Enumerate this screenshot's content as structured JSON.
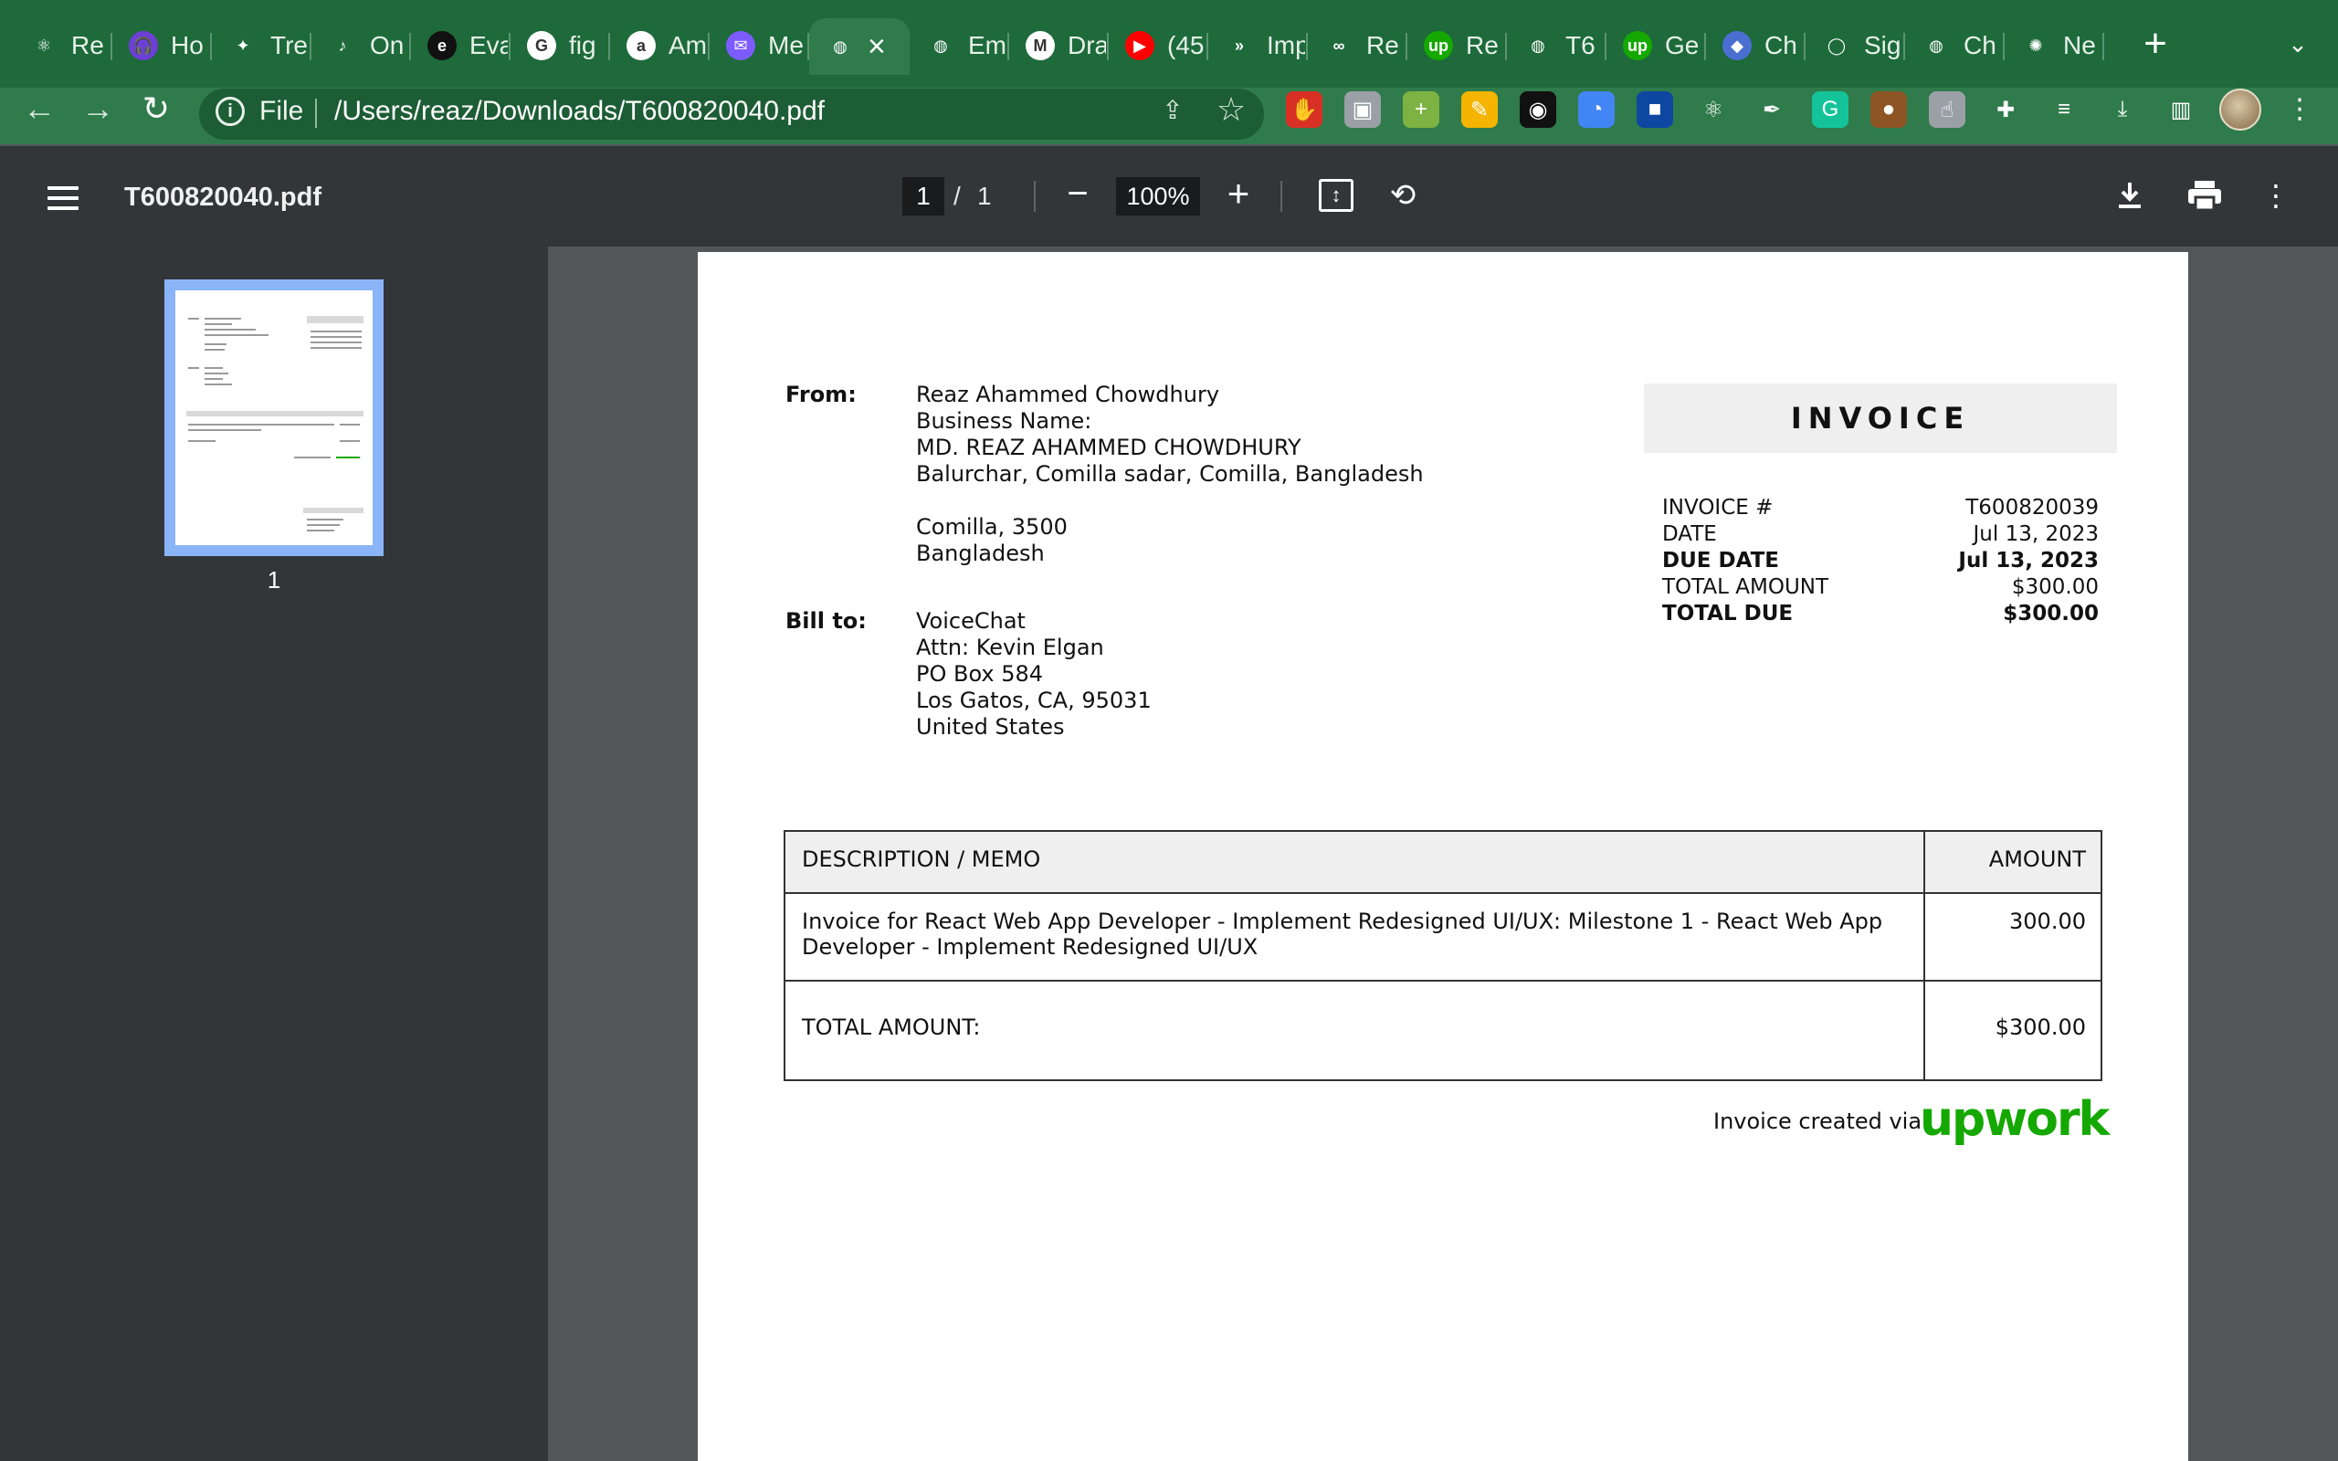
{
  "tabs": [
    {
      "label": "Re",
      "icon": "react-icon",
      "color": "#1e6a3b",
      "glyph": "⚛"
    },
    {
      "label": "Ho",
      "icon": "headphones-icon",
      "color": "#6d3fd6",
      "glyph": "🎧"
    },
    {
      "label": "Tre",
      "icon": "figma-icon",
      "color": "#1e6a3b",
      "glyph": "✦"
    },
    {
      "label": "On",
      "icon": "music-note-icon",
      "color": "#1e6a3b",
      "glyph": "♪"
    },
    {
      "label": "Eva",
      "icon": "e-logo-icon",
      "color": "#111111",
      "glyph": "e"
    },
    {
      "label": "fig",
      "icon": "google-icon",
      "color": "#ffffff",
      "glyph": "G"
    },
    {
      "label": "Am",
      "icon": "amazon-icon",
      "color": "#ffffff",
      "glyph": "a"
    },
    {
      "label": "Me",
      "icon": "messenger-icon",
      "color": "#7c5cff",
      "glyph": "✉"
    },
    {
      "label": "",
      "icon": "globe-icon",
      "color": "#2f7b4b",
      "glyph": "◍",
      "active": true
    },
    {
      "label": "Em",
      "icon": "globe-icon",
      "color": "#1e6a3b",
      "glyph": "◍"
    },
    {
      "label": "Dra",
      "icon": "gmail-icon",
      "color": "#ffffff",
      "glyph": "M"
    },
    {
      "label": "(45",
      "icon": "youtube-icon",
      "color": "#ff0000",
      "glyph": "▶"
    },
    {
      "label": "Imp",
      "icon": "arrows-icon",
      "color": "#1e6a3b",
      "glyph": "»"
    },
    {
      "label": "Re",
      "icon": "knot-icon",
      "color": "#1e6a3b",
      "glyph": "∞"
    },
    {
      "label": "Re",
      "icon": "upwork-icon",
      "color": "#14a800",
      "glyph": "up"
    },
    {
      "label": "T6",
      "icon": "globe-icon",
      "color": "#1e6a3b",
      "glyph": "◍"
    },
    {
      "label": "Ge",
      "icon": "upwork-icon",
      "color": "#14a800",
      "glyph": "up"
    },
    {
      "label": "Ch",
      "icon": "photo-icon",
      "color": "#4a6fd1",
      "glyph": "◆"
    },
    {
      "label": "Sig",
      "icon": "ring-icon",
      "color": "#1e6a3b",
      "glyph": "◯"
    },
    {
      "label": "Ch",
      "icon": "globe-icon",
      "color": "#1e6a3b",
      "glyph": "◍"
    },
    {
      "label": "Ne",
      "icon": "chatgpt-icon",
      "color": "#1e6a3b",
      "glyph": "✺"
    }
  ],
  "browser": {
    "scheme": "File",
    "url": "/Users/reaz/Downloads/T600820040.pdf"
  },
  "extensions": [
    {
      "name": "stop-hand-icon",
      "bg": "#d93025",
      "glyph": "✋"
    },
    {
      "name": "camera-icon",
      "bg": "#9aa0a6",
      "glyph": "▣"
    },
    {
      "name": "plus-circle-icon",
      "bg": "#7cb342",
      "glyph": "+"
    },
    {
      "name": "pencil-color-icon",
      "bg": "#f4b400",
      "glyph": "✎"
    },
    {
      "name": "reader-icon",
      "bg": "#111111",
      "glyph": "◉"
    },
    {
      "name": "color-wheel-icon",
      "bg": "#4285f4",
      "glyph": "◔"
    },
    {
      "name": "book-icon",
      "bg": "#0d47a1",
      "glyph": "■"
    },
    {
      "name": "react-devtools-icon",
      "bg": "#2f7b4b",
      "glyph": "⚛"
    },
    {
      "name": "eyedropper-icon",
      "bg": "#2f7b4b",
      "glyph": "✒"
    },
    {
      "name": "grammarly-icon",
      "bg": "#15c39a",
      "glyph": "G"
    },
    {
      "name": "cookie-icon",
      "bg": "#8d5524",
      "glyph": "●"
    },
    {
      "name": "touch-icon",
      "bg": "#9aa0a6",
      "glyph": "☝"
    },
    {
      "name": "puzzle-extensions-icon",
      "bg": "#2f7b4b",
      "glyph": "✚"
    },
    {
      "name": "media-queue-icon",
      "bg": "#2f7b4b",
      "glyph": "≡"
    },
    {
      "name": "downloads-icon",
      "bg": "#2f7b4b",
      "glyph": "⤓"
    },
    {
      "name": "side-panel-icon",
      "bg": "#2f7b4b",
      "glyph": "▥"
    }
  ],
  "pdf": {
    "title": "T600820040.pdf",
    "page_current": "1",
    "page_separator": "/",
    "page_total": "1",
    "zoom": "100%",
    "thumbnail_number": "1"
  },
  "invoice": {
    "from_label": "From:",
    "from_lines": [
      "Reaz Ahammed Chowdhury",
      "Business Name:",
      "MD. REAZ AHAMMED CHOWDHURY",
      "Balurchar, Comilla sadar, Comilla, Bangladesh",
      "",
      "Comilla, 3500",
      "Bangladesh"
    ],
    "bill_label": "Bill to:",
    "bill_lines": [
      "VoiceChat",
      "Attn: Kevin Elgan",
      "PO Box 584",
      "Los Gatos, CA, 95031",
      "United States"
    ],
    "heading": "INVOICE",
    "meta": [
      {
        "k": "INVOICE #",
        "v": "T600820039",
        "bold": false
      },
      {
        "k": "DATE",
        "v": "Jul 13, 2023",
        "bold": false
      },
      {
        "k": "DUE DATE",
        "v": "Jul 13, 2023",
        "bold": true
      },
      {
        "k": "TOTAL AMOUNT",
        "v": "$300.00",
        "bold": false
      },
      {
        "k": "TOTAL DUE",
        "v": "$300.00",
        "bold": true
      }
    ],
    "table": {
      "col_description": "DESCRIPTION / MEMO",
      "col_amount": "AMOUNT",
      "item_description_line1": "Invoice for React Web App Developer - Implement Redesigned UI/UX: Milestone 1 - React Web App",
      "item_description_line2": "Developer - Implement Redesigned UI/UX",
      "item_amount": "300.00",
      "total_label": "TOTAL AMOUNT:",
      "total_value": "$300.00"
    },
    "footer": "Invoice created via",
    "brand": "upwork",
    "brand_color": "#14a800"
  }
}
